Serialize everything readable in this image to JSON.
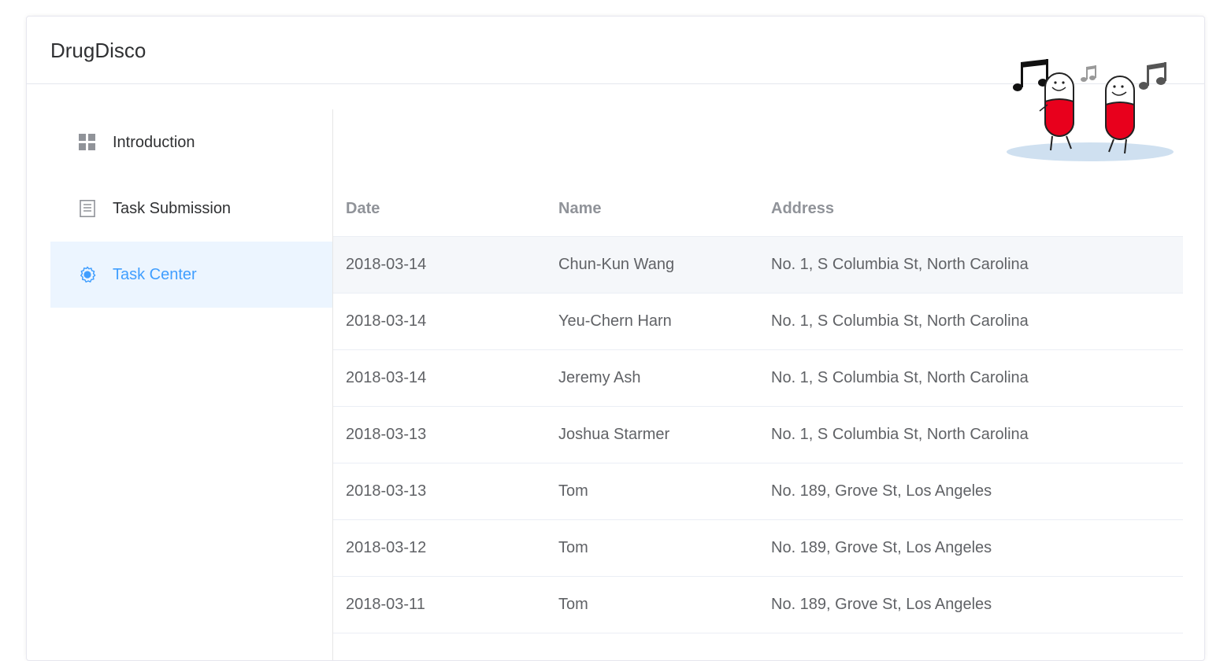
{
  "app": {
    "title": "DrugDisco"
  },
  "sidebar": {
    "items": [
      {
        "label": "Introduction",
        "icon": "grid-icon",
        "active": false
      },
      {
        "label": "Task Submission",
        "icon": "document-icon",
        "active": false
      },
      {
        "label": "Task Center",
        "icon": "gear-icon",
        "active": true
      }
    ]
  },
  "table": {
    "columns": [
      "Date",
      "Name",
      "Address"
    ],
    "rows": [
      {
        "date": "2018-03-14",
        "name": "Chun-Kun Wang",
        "address": "No. 1, S Columbia St, North Carolina"
      },
      {
        "date": "2018-03-14",
        "name": "Yeu-Chern Harn",
        "address": "No. 1, S Columbia St, North Carolina"
      },
      {
        "date": "2018-03-14",
        "name": "Jeremy Ash",
        "address": "No. 1, S Columbia St, North Carolina"
      },
      {
        "date": "2018-03-13",
        "name": "Joshua Starmer",
        "address": "No. 1, S Columbia St, North Carolina"
      },
      {
        "date": "2018-03-13",
        "name": "Tom",
        "address": "No. 189, Grove St, Los Angeles"
      },
      {
        "date": "2018-03-12",
        "name": "Tom",
        "address": "No. 189, Grove St, Los Angeles"
      },
      {
        "date": "2018-03-11",
        "name": "Tom",
        "address": "No. 189, Grove St, Los Angeles"
      }
    ]
  },
  "colors": {
    "accent": "#409eff",
    "active_bg": "#ecf5ff",
    "hover_row_bg": "#f5f7fa",
    "pill_red": "#e8001c"
  }
}
